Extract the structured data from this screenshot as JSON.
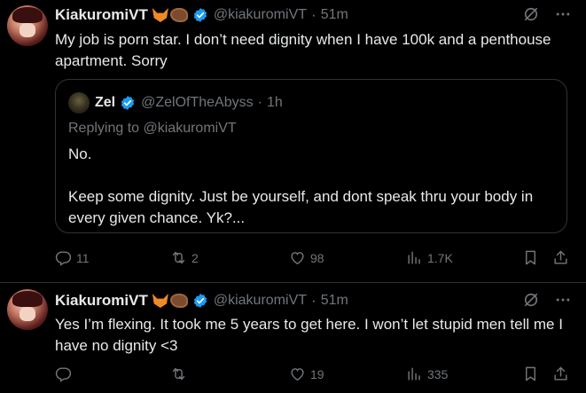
{
  "posts": [
    {
      "author": "KiakuromiVT",
      "handle": "@kiakuromiVT",
      "time": "51m",
      "text": "My job is porn star. I don’t need dignity when I have 100k and a penthouse apartment. Sorry",
      "quote": {
        "author": "Zel",
        "handle": "@ZelOfTheAbyss",
        "time": "1h",
        "replying_to": "Replying to @kiakuromiVT",
        "text": "No.\n\nKeep some dignity. Just be yourself, and dont speak thru your body in every given chance. Yk?..."
      },
      "stats": {
        "replies": "11",
        "reposts": "2",
        "likes": "98",
        "views": "1.7K"
      }
    },
    {
      "author": "KiakuromiVT",
      "handle": "@kiakuromiVT",
      "time": "51m",
      "text": "Yes I’m flexing. It took me 5 years to get here. I won’t let stupid men tell me I have no dignity <3",
      "stats": {
        "replies": "",
        "reposts": "",
        "likes": "19",
        "views": "335"
      }
    }
  ],
  "separator_dot": "·",
  "colors": {
    "verified": "#1d9bf0",
    "muted": "#71767b",
    "text": "#e7e9ea",
    "border": "#2f3336"
  }
}
